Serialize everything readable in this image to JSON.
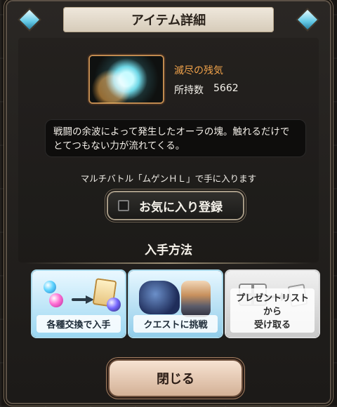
{
  "dialog": {
    "title": "アイテム詳細",
    "item": {
      "name": "滅尽の残気",
      "count_label": "所持数",
      "count_value": "5662",
      "icon": "aura-fragment-icon"
    },
    "description_line1": "戦闘の余波によって発生したオーラの塊。触れるだけで",
    "description_line2": "とてつもない力が流れてくる。",
    "obtain_note": "マルチバトル「ムゲンＨＬ」で手に入ります",
    "favorite": {
      "label": "お気に入り登録",
      "checked": false
    },
    "how_to_obtain_title": "入手方法",
    "methods": [
      {
        "label": "各種交換で入手",
        "icon": "exchange-icon"
      },
      {
        "label": "クエストに挑戦",
        "icon": "quest-icon"
      },
      {
        "label_line1": "プレゼントリストから",
        "label_line2": "受け取る",
        "icon": "gift-list-icon"
      }
    ],
    "close_label": "閉じる"
  },
  "colors": {
    "accent_orange": "#f0a24a",
    "frame_gold": "#a69a86",
    "method_blue": "#9bd7f2",
    "method_gray": "#c9c9c9"
  }
}
